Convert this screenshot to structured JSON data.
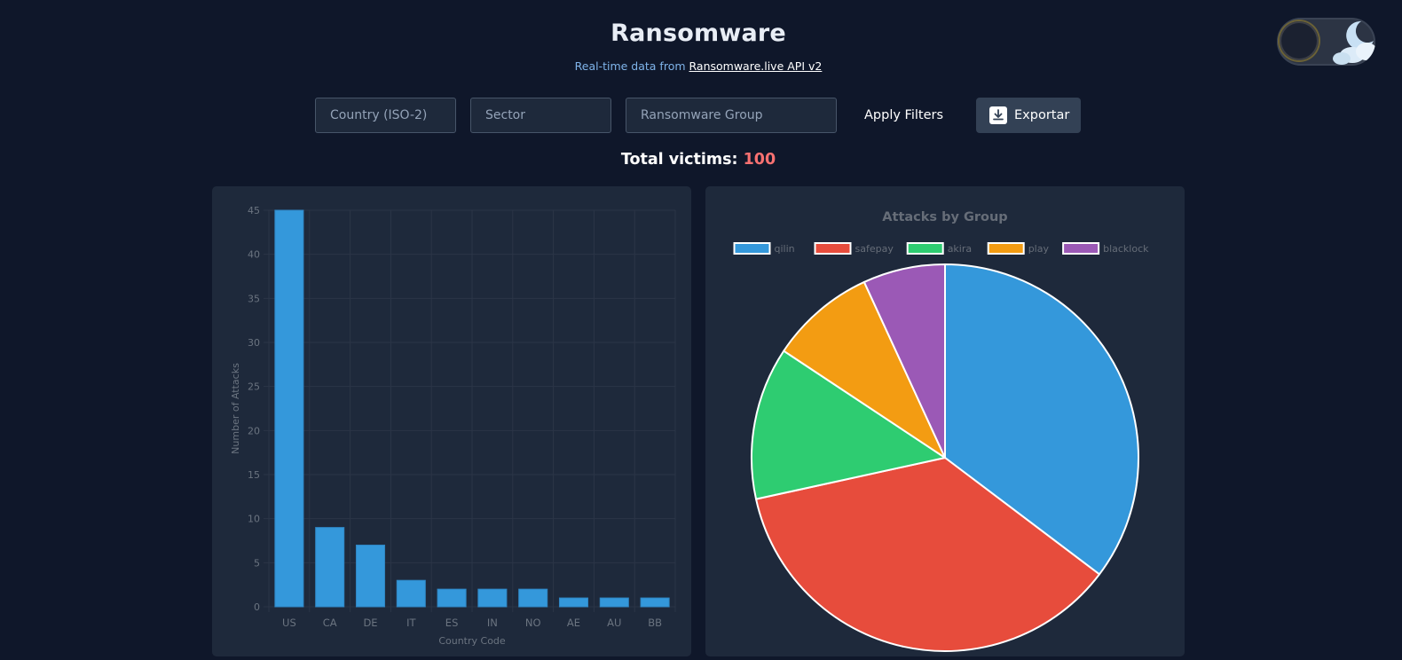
{
  "header": {
    "title": "Ransomware",
    "subtitle_prefix": "Real-time data from ",
    "subtitle_link": "Ransomware.live API v2"
  },
  "theme_toggle": {
    "state": "dark",
    "icons": [
      "moon-icon",
      "cloud-icon"
    ]
  },
  "filters": {
    "country_placeholder": "Country (ISO-2)",
    "sector_placeholder": "Sector",
    "group_placeholder": "Ransomware Group",
    "apply_label": "Apply Filters",
    "export_label": "Exportar",
    "export_icon": "download-icon"
  },
  "summary": {
    "label": "Total victims:",
    "value": "100"
  },
  "colors": {
    "background": "#0f172a",
    "card": "#1e293b",
    "bar": "#3498db",
    "total_value": "#f87171"
  },
  "chart_data": [
    {
      "type": "bar",
      "title": "",
      "xlabel": "Country Code",
      "ylabel": "Number of Attacks",
      "categories": [
        "US",
        "CA",
        "DE",
        "IT",
        "ES",
        "IN",
        "NO",
        "AE",
        "AU",
        "BB"
      ],
      "values": [
        45,
        9,
        7,
        3,
        2,
        2,
        2,
        1,
        1,
        1
      ],
      "ylim": [
        0,
        45
      ],
      "yticks": [
        0,
        5,
        10,
        15,
        20,
        25,
        30,
        35,
        40,
        45
      ],
      "grid": true,
      "legend": "none",
      "color": "#3498db"
    },
    {
      "type": "pie",
      "title": "Attacks by Group",
      "legend": "top",
      "labels": [
        "qilin",
        "safepay",
        "akira",
        "play",
        "blacklock"
      ],
      "values": [
        36,
        37,
        13,
        9,
        7
      ],
      "colors": [
        "#3498db",
        "#e74c3c",
        "#2ecc71",
        "#f39c12",
        "#9b59b6"
      ]
    }
  ]
}
